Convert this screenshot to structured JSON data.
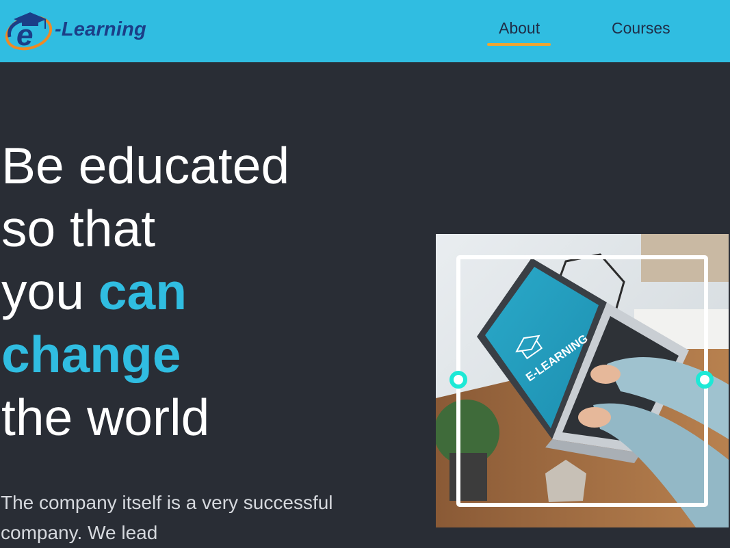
{
  "brand": {
    "logo_text": "-Learning",
    "logo_icon": "graduation-cap-e-icon",
    "colors": {
      "navbar": "#30bde1",
      "accent": "#30bde1",
      "underline": "#f0a530",
      "logo_text": "#1b3e87",
      "background": "#292d35"
    }
  },
  "nav": {
    "items": [
      {
        "label": "About",
        "active": true
      },
      {
        "label": "Courses",
        "active": false
      }
    ]
  },
  "hero": {
    "title_line1": "Be educated",
    "title_line2": "so that",
    "title_line3_plain": "you ",
    "title_line3_accent": "can",
    "title_line4_accent": "change",
    "title_line5": "the world",
    "description": "The company itself is a very successful company. We lead",
    "image": {
      "subject": "laptop-e-learning-photo",
      "screen_text": "E-LEARNING",
      "frame_color": "#ffffff",
      "handle_color": "#1de9d6"
    }
  }
}
